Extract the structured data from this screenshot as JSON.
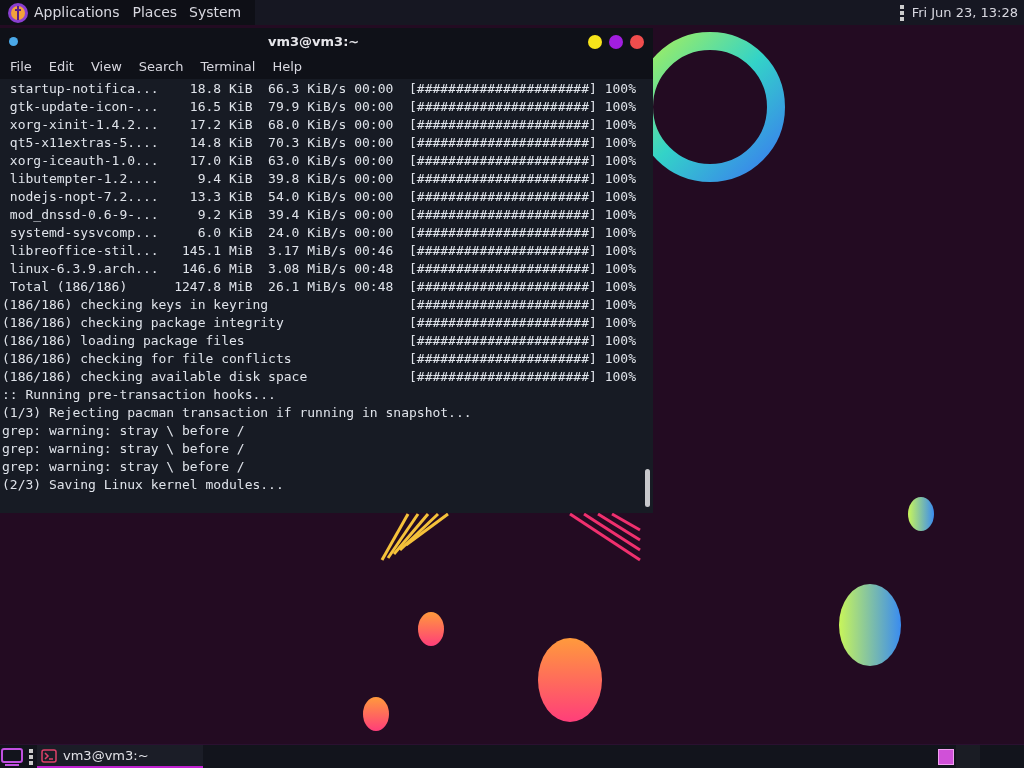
{
  "top_panel": {
    "menus": [
      "Applications",
      "Places",
      "System"
    ],
    "clock": "Fri Jun 23, 13:28"
  },
  "terminal": {
    "title": "vm3@vm3:~",
    "menu": [
      "File",
      "Edit",
      "View",
      "Search",
      "Terminal",
      "Help"
    ],
    "downloads": [
      {
        "name": "startup-notifica...",
        "size": "18.8 KiB",
        "rate": "66.3 KiB/s",
        "time": "00:00",
        "bar": "[######################]",
        "percent": "100%"
      },
      {
        "name": "gtk-update-icon-...",
        "size": "16.5 KiB",
        "rate": "79.9 KiB/s",
        "time": "00:00",
        "bar": "[######################]",
        "percent": "100%"
      },
      {
        "name": "xorg-xinit-1.4.2...",
        "size": "17.2 KiB",
        "rate": "68.0 KiB/s",
        "time": "00:00",
        "bar": "[######################]",
        "percent": "100%"
      },
      {
        "name": "qt5-x11extras-5....",
        "size": "14.8 KiB",
        "rate": "70.3 KiB/s",
        "time": "00:00",
        "bar": "[######################]",
        "percent": "100%"
      },
      {
        "name": "xorg-iceauth-1.0...",
        "size": "17.0 KiB",
        "rate": "63.0 KiB/s",
        "time": "00:00",
        "bar": "[######################]",
        "percent": "100%"
      },
      {
        "name": "libutempter-1.2....",
        "size": "9.4 KiB",
        "rate": "39.8 KiB/s",
        "time": "00:00",
        "bar": "[######################]",
        "percent": "100%"
      },
      {
        "name": "nodejs-nopt-7.2....",
        "size": "13.3 KiB",
        "rate": "54.0 KiB/s",
        "time": "00:00",
        "bar": "[######################]",
        "percent": "100%"
      },
      {
        "name": "mod_dnssd-0.6-9-...",
        "size": "9.2 KiB",
        "rate": "39.4 KiB/s",
        "time": "00:00",
        "bar": "[######################]",
        "percent": "100%"
      },
      {
        "name": "systemd-sysvcomp...",
        "size": "6.0 KiB",
        "rate": "24.0 KiB/s",
        "time": "00:00",
        "bar": "[######################]",
        "percent": "100%"
      },
      {
        "name": "libreoffice-stil...",
        "size": "145.1 MiB",
        "rate": "3.17 MiB/s",
        "time": "00:46",
        "bar": "[######################]",
        "percent": "100%"
      },
      {
        "name": "linux-6.3.9.arch...",
        "size": "146.6 MiB",
        "rate": "3.08 MiB/s",
        "time": "00:48",
        "bar": "[######################]",
        "percent": "100%"
      },
      {
        "name": "Total (186/186)",
        "size": "1247.8 MiB",
        "rate": "26.1 MiB/s",
        "time": "00:48",
        "bar": "[######################]",
        "percent": "100%"
      }
    ],
    "checks": [
      {
        "label": "(186/186) checking keys in keyring",
        "bar": "[######################]",
        "percent": "100%"
      },
      {
        "label": "(186/186) checking package integrity",
        "bar": "[######################]",
        "percent": "100%"
      },
      {
        "label": "(186/186) loading package files",
        "bar": "[######################]",
        "percent": "100%"
      },
      {
        "label": "(186/186) checking for file conflicts",
        "bar": "[######################]",
        "percent": "100%"
      },
      {
        "label": "(186/186) checking available disk space",
        "bar": "[######################]",
        "percent": "100%"
      }
    ],
    "output": [
      ":: Running pre-transaction hooks...",
      "(1/3) Rejecting pacman transaction if running in snapshot...",
      "grep: warning: stray \\ before /",
      "grep: warning: stray \\ before /",
      "grep: warning: stray \\ before /",
      "(2/3) Saving Linux kernel modules..."
    ]
  },
  "taskbar": {
    "tasks": [
      {
        "label": "vm3@vm3:~",
        "selected": true
      }
    ],
    "workspaces": [
      {
        "selected": true
      },
      {
        "selected": false
      }
    ]
  }
}
